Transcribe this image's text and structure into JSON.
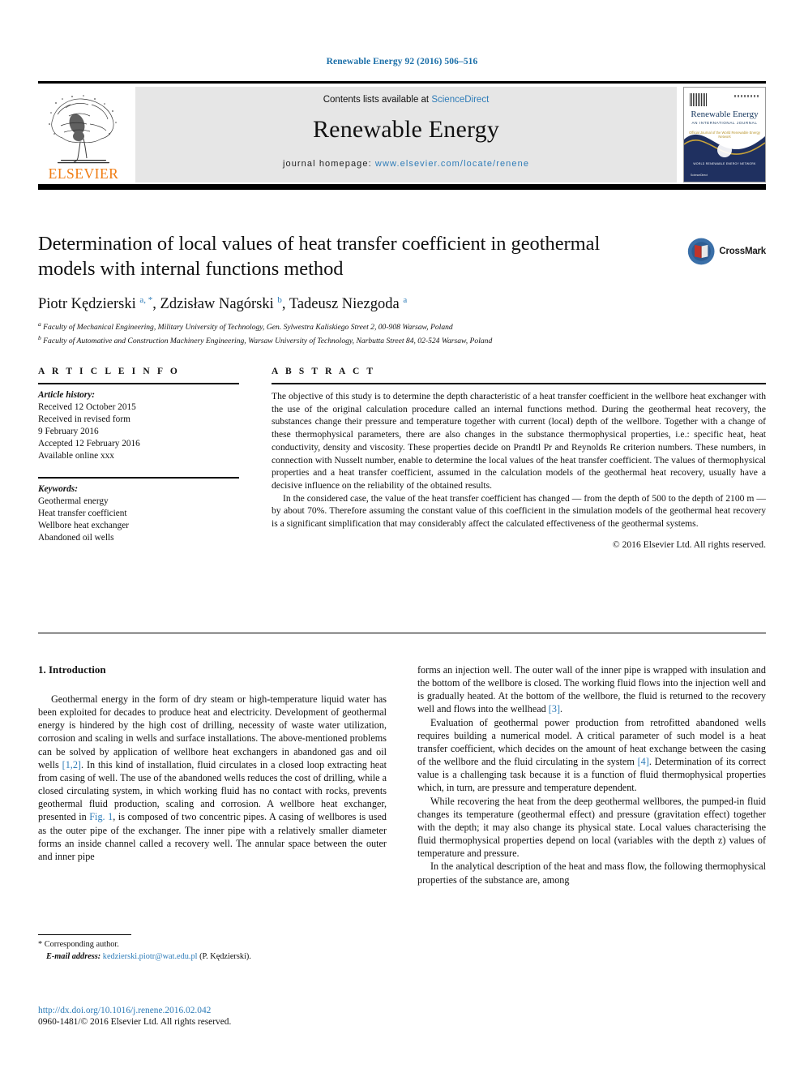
{
  "running_head": "Renewable Energy 92 (2016) 506–516",
  "masthead": {
    "contents_prefix": "Contents lists available at ",
    "sciencedirect": "ScienceDirect",
    "journal_title": "Renewable Energy",
    "homepage_label": "journal homepage: ",
    "homepage_url": "www.elsevier.com/locate/renene",
    "publisher": "ELSEVIER",
    "cover": {
      "title": "Renewable Energy",
      "subtitle": "AN INTERNATIONAL JOURNAL",
      "tagline": "Official Journal of the World Renewable Energy Network",
      "emblem_text": "WORLD RENEWABLE\nENERGY NETWORK",
      "footer": "ScienceDirect"
    }
  },
  "article": {
    "title": "Determination of local values of heat transfer coefficient in geothermal models with internal functions method",
    "crossmark_label": "CrossMark",
    "authors_html": "Piotr Kędzierski <sup>a, *</sup>, Zdzisław Nagórski <sup>b</sup>, Tadeusz Niezgoda <sup>a</sup>",
    "affiliations": [
      "Faculty of Mechanical Engineering, Military University of Technology, Gen. Sylwestra Kaliskiego Street 2, 00-908 Warsaw, Poland",
      "Faculty of Automative and Construction Machinery Engineering, Warsaw University of Technology, Narbutta Street 84, 02-524 Warsaw, Poland"
    ]
  },
  "article_info": {
    "heading": "A R T I C L E   I N F O",
    "history_label": "Article history:",
    "history": [
      "Received 12 October 2015",
      "Received in revised form",
      "9 February 2016",
      "Accepted 12 February 2016",
      "Available online xxx"
    ],
    "keywords_label": "Keywords:",
    "keywords": [
      "Geothermal energy",
      "Heat transfer coefficient",
      "Wellbore heat exchanger",
      "Abandoned oil wells"
    ]
  },
  "abstract": {
    "heading": "A B S T R A C T",
    "paragraph1": "The objective of this study is to determine the depth characteristic of a heat transfer coefficient in the wellbore heat exchanger with the use of the original calculation procedure called an internal functions method. During the geothermal heat recovery, the substances change their pressure and temperature together with current (local) depth of the wellbore. Together with a change of these thermophysical parameters, there are also changes in the substance thermophysical properties, i.e.: specific heat, heat conductivity, density and viscosity. These properties decide on Prandtl Pr and Reynolds Re criterion numbers. These numbers, in connection with Nusselt number, enable to determine the local values of the heat transfer coefficient. The values of thermophysical properties and a heat transfer coefficient, assumed in the calculation models of the geothermal heat recovery, usually have a decisive influence on the reliability of the obtained results.",
    "paragraph2": "In the considered case, the value of the heat transfer coefficient has changed — from the depth of 500 to the depth of 2100 m — by about 70%. Therefore assuming the constant value of this coefficient in the simulation models of the geothermal heat recovery is a significant simplification that may considerably affect the calculated effectiveness of the geothermal systems.",
    "copyright": "© 2016 Elsevier Ltd. All rights reserved."
  },
  "body": {
    "section_heading": "1. Introduction",
    "left_col": [
      "Geothermal energy in the form of dry steam or high-temperature liquid water has been exploited for decades to produce heat and electricity. Development of geothermal energy is hindered by the high cost of drilling, necessity of waste water utilization, corrosion and scaling in wells and surface installations. The above-mentioned problems can be solved by application of wellbore heat exchangers in abandoned gas and oil wells [1,2]. In this kind of installation, fluid circulates in a closed loop extracting heat from casing of well. The use of the abandoned wells reduces the cost of drilling, while a closed circulating system, in which working fluid has no contact with rocks, prevents geothermal fluid production, scaling and corrosion. A wellbore heat exchanger, presented in Fig. 1, is composed of two concentric pipes. A casing of wellbores is used as the outer pipe of the exchanger. The inner pipe with a relatively smaller diameter forms an inside channel called a recovery well. The annular space between the outer and inner pipe"
    ],
    "right_col": [
      "forms an injection well. The outer wall of the inner pipe is wrapped with insulation and the bottom of the wellbore is closed. The working fluid flows into the injection well and is gradually heated. At the bottom of the wellbore, the fluid is returned to the recovery well and flows into the wellhead [3].",
      "Evaluation of geothermal power production from retrofitted abandoned wells requires building a numerical model. A critical parameter of such model is a heat transfer coefficient, which decides on the amount of heat exchange between the casing of the wellbore and the fluid circulating in the system [4]. Determination of its correct value is a challenging task because it is a function of fluid thermophysical properties which, in turn, are pressure and temperature dependent.",
      "While recovering the heat from the deep geothermal wellbores, the pumped-in fluid changes its temperature (geothermal effect) and pressure (gravitation effect) together with the depth; it may also change its physical state. Local values characterising the fluid thermophysical properties depend on local (variables with the depth z) values of temperature and pressure.",
      "In the analytical description of the heat and mass flow, the following thermophysical properties of the substance are, among"
    ],
    "inline_refs": [
      "[1,2]",
      "Fig. 1",
      "[3]",
      "[4]"
    ]
  },
  "footnote": {
    "corresponding": "* Corresponding author.",
    "email_label": "E-mail address:",
    "email": "kedzierski.piotr@wat.edu.pl",
    "email_suffix": "(P. Kędzierski)."
  },
  "footer": {
    "doi": "http://dx.doi.org/10.1016/j.renene.2016.02.042",
    "issn": "0960-1481/© 2016 Elsevier Ltd. All rights reserved."
  },
  "colors": {
    "link_blue": "#2e7cb8",
    "elsevier_orange": "#f07c12",
    "masthead_gray": "#e6e6e6",
    "cover_navy": "#1f3060"
  }
}
